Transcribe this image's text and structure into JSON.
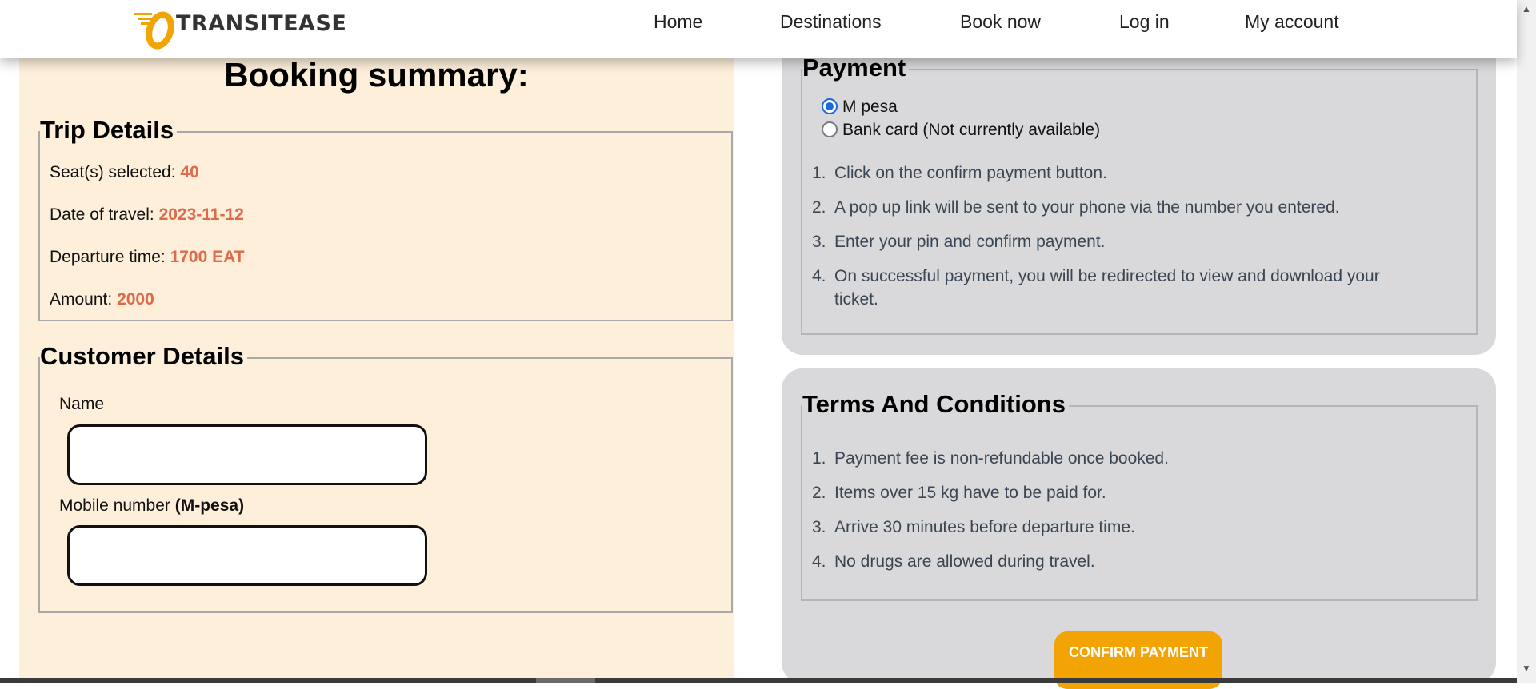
{
  "header": {
    "brand": "TRANSITEASE",
    "nav": [
      "Home",
      "Destinations",
      "Book now",
      "Log in",
      "My account"
    ],
    "brand_color": "#f2a405"
  },
  "summary": {
    "title": "Booking summary:",
    "trip": {
      "legend": "Trip Details",
      "seats_label": "Seat(s) selected:",
      "seats_value": "40",
      "date_label": "Date of travel:",
      "date_value": "2023-11-12",
      "time_label": "Departure time:",
      "time_value": "1700 EAT",
      "amount_label": "Amount:",
      "amount_value": "2000"
    },
    "customer": {
      "legend": "Customer Details",
      "name_label": "Name",
      "name_value": "",
      "mobile_label": "Mobile number",
      "mobile_hint": "(M-pesa)",
      "mobile_value": ""
    }
  },
  "payment": {
    "legend": "Payment",
    "options": [
      {
        "label": "M pesa",
        "selected": true
      },
      {
        "label": "Bank card (Not currently available)",
        "selected": false
      }
    ],
    "steps": [
      "Click on the confirm payment button.",
      "A pop up link will be sent to your phone via the number you entered.",
      "Enter your pin and confirm payment.",
      "On successful payment, you will be redirected to view and download your ticket."
    ]
  },
  "terms": {
    "legend": "Terms And Conditions",
    "items": [
      "Payment fee is non-refundable once booked.",
      "Items over 15 kg have to be paid for.",
      "Arrive 30 minutes before departure time.",
      "No drugs are allowed during travel."
    ]
  },
  "confirm_button": "CONFIRM PAYMENT",
  "colors": {
    "accent_value": "#dd6a4a",
    "panel_left": "#fdefda",
    "card_bg": "#d9d9db",
    "button": "#f2a405"
  }
}
